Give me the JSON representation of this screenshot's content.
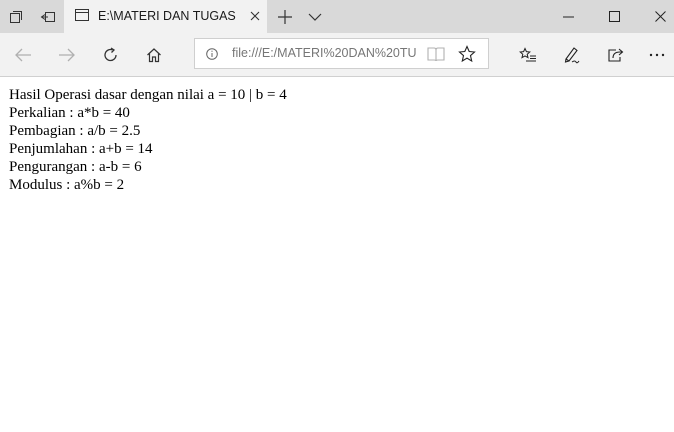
{
  "tab": {
    "title": "E:\\MATERI DAN TUGAS"
  },
  "address": {
    "url": "file:///E:/MATERI%20DAN%20TU"
  },
  "content": {
    "lines": [
      "Hasil Operasi dasar dengan nilai a = 10 | b = 4",
      "Perkalian : a*b = 40",
      "Pembagian : a/b = 2.5",
      "Penjumlahan : a+b = 14",
      "Pengurangan : a-b = 6",
      "Modulus : a%b = 2"
    ]
  }
}
